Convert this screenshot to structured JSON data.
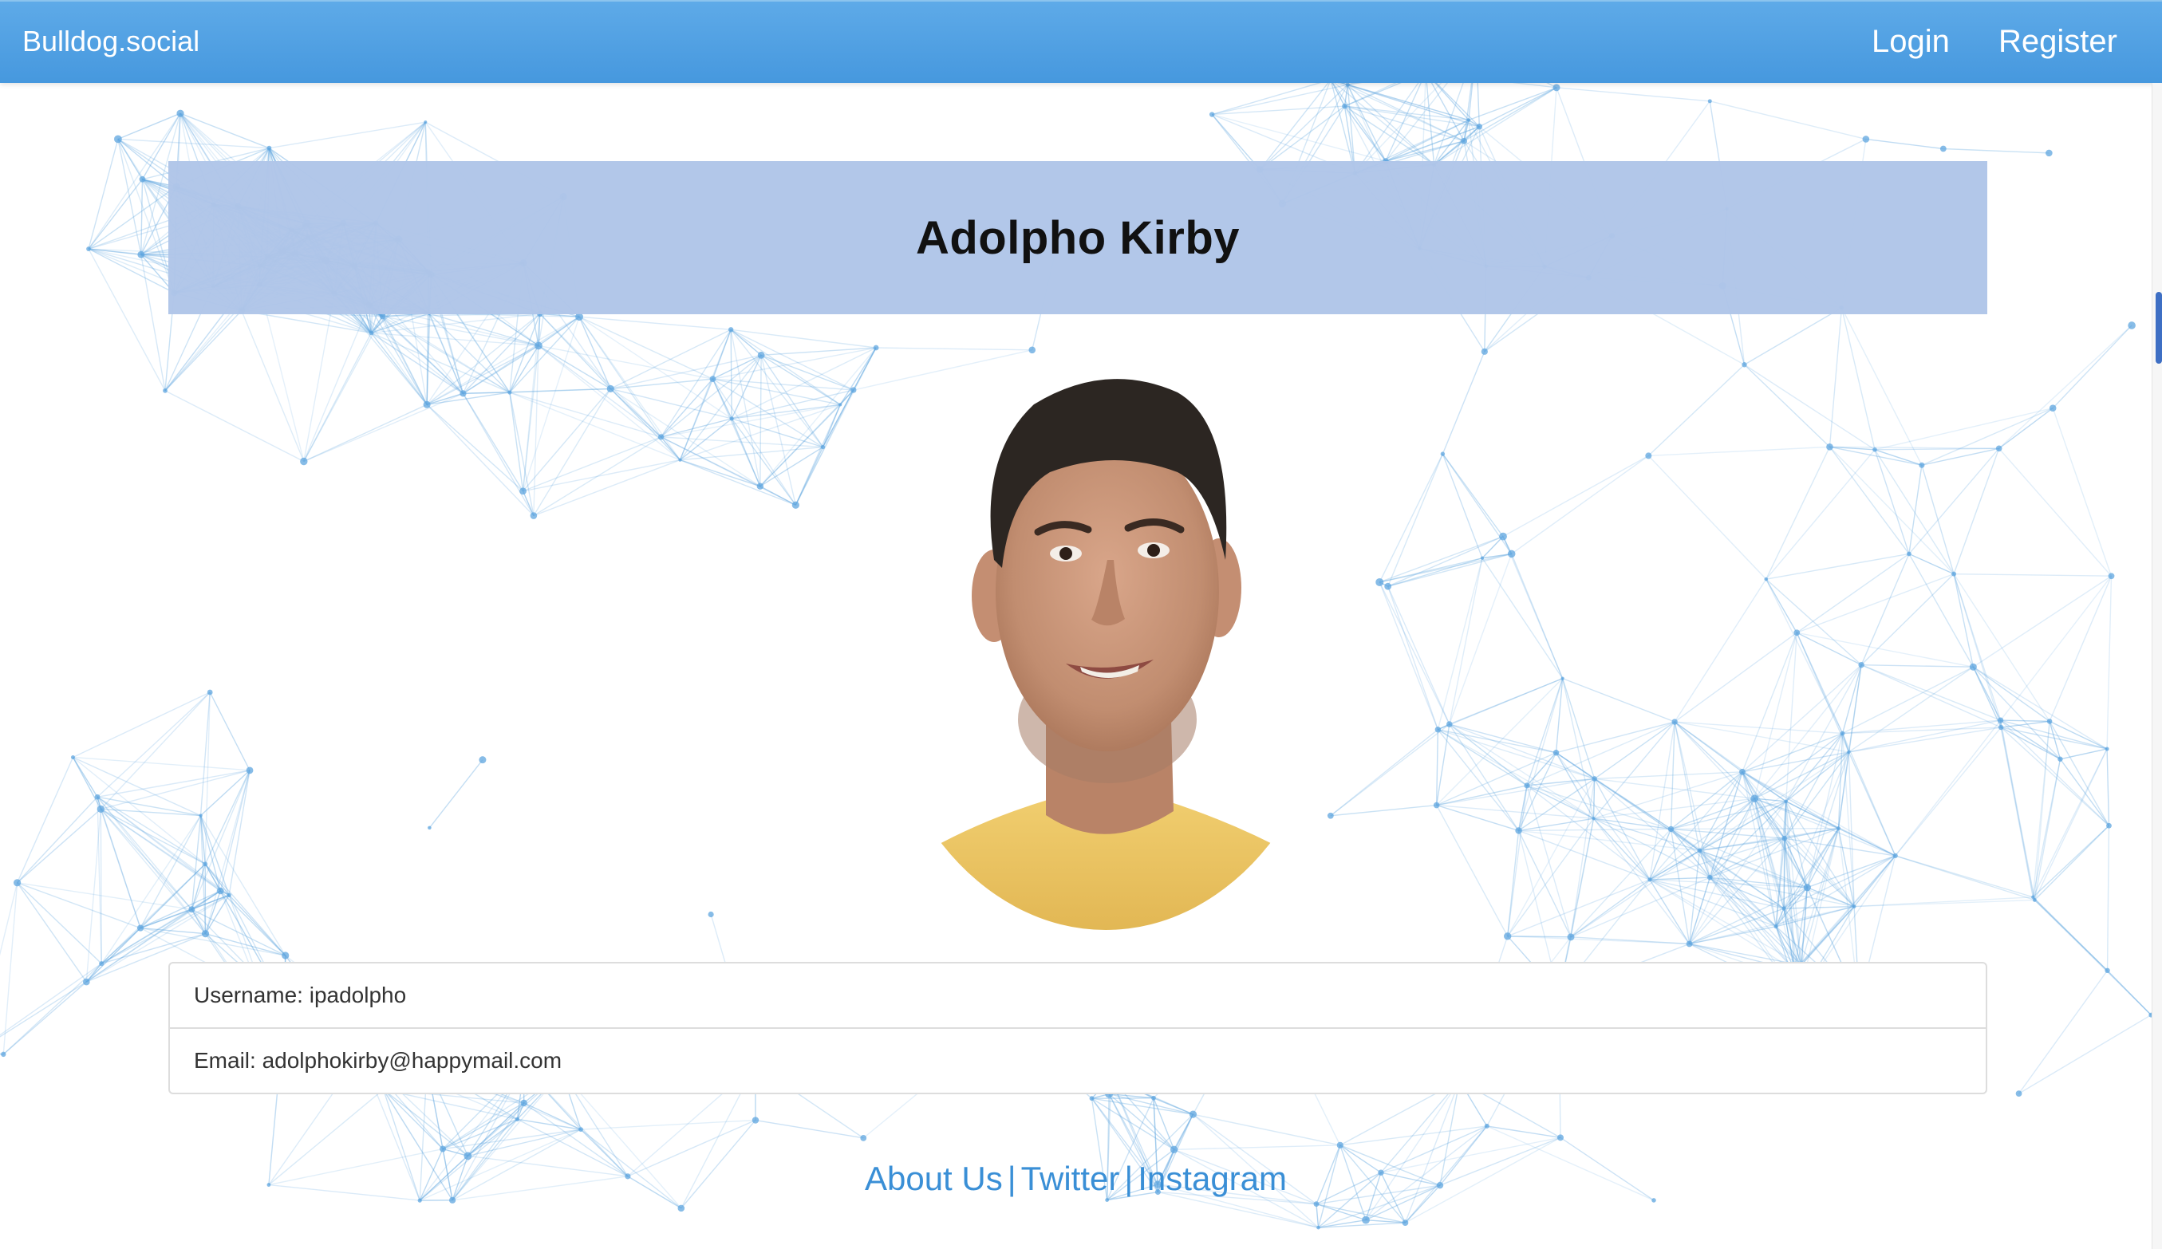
{
  "navbar": {
    "brand": "Bulldog.social",
    "login_label": "Login",
    "register_label": "Register"
  },
  "profile": {
    "name": "Adolpho Kirby",
    "username_label": "Username:",
    "username": "ipadolpho",
    "email_label": "Email:",
    "email": "adolphokirby@happymail.com"
  },
  "footer": {
    "about_label": "About Us",
    "twitter_label": "Twitter",
    "instagram_label": "Instagram",
    "separator": "|"
  },
  "colors": {
    "navbar": "#4a9ee2",
    "title_banner": "#b0c5e8",
    "link": "#3a8fd6",
    "network_lines": "#5fa6df"
  }
}
